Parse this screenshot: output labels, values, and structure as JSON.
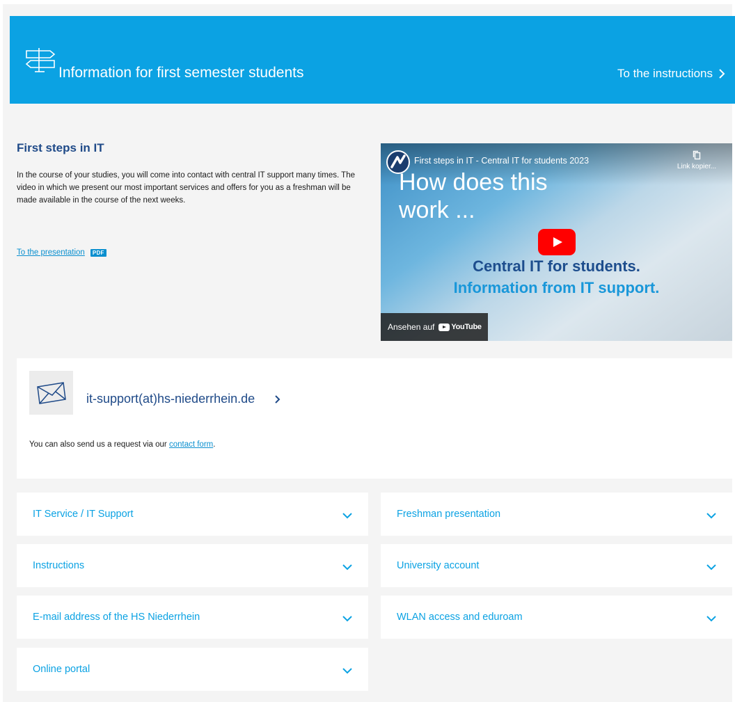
{
  "banner": {
    "title": "Information for first semester students",
    "link_label": "To the instructions",
    "icon": "signpost-icon"
  },
  "intro": {
    "title": "First steps in IT",
    "text": "In the course of your studies, you will come into contact with central IT support many times. The video in which we present our most important services and offers for you as a freshman will be made available in the course of the next weeks.",
    "presentation_link": "To the presentation",
    "pdf_badge": "PDF"
  },
  "video": {
    "title": "First steps in IT - Central IT for students 2023",
    "copy_label": "Link kopier...",
    "headline": "How does this work ...",
    "line1": "Central IT for students.",
    "line2": "Information from IT support.",
    "watch_label": "Ansehen auf",
    "youtube_label": "YouTube"
  },
  "contact": {
    "email": "it-support(at)hs-niederrhein.de",
    "note_prefix": "You can also send us a request via our ",
    "note_link": "contact form",
    "note_suffix": "."
  },
  "accordion": [
    {
      "label": "IT Service / IT Support"
    },
    {
      "label": "Freshman presentation"
    },
    {
      "label": "Instructions"
    },
    {
      "label": "University account"
    },
    {
      "label": "E-mail address of the HS Niederrhein"
    },
    {
      "label": "WLAN access and eduroam"
    },
    {
      "label": "Online portal"
    }
  ],
  "colors": {
    "brand_blue": "#0ba2e3",
    "heading_navy": "#1f4a88",
    "link_blue": "#0a8fcf",
    "background": "#f4f4f4"
  }
}
